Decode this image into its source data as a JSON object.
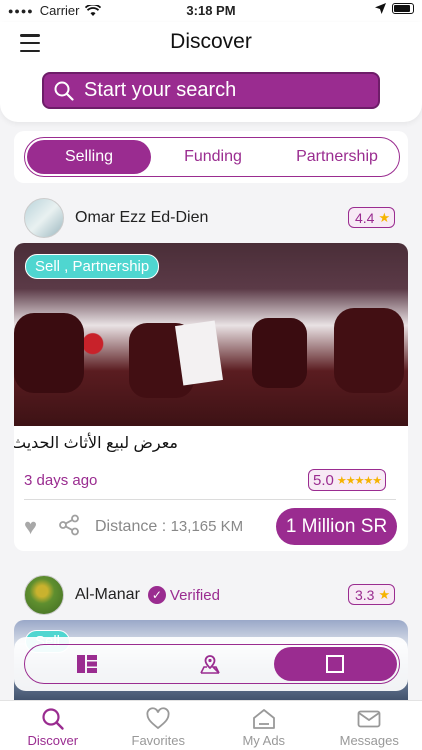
{
  "status_bar": {
    "carrier": "Carrier",
    "time": "3:18 PM"
  },
  "header": {
    "title": "Discover",
    "menu_icon": "hamburger-menu-icon"
  },
  "search": {
    "placeholder": "Start your search",
    "icon": "search-icon"
  },
  "segments": {
    "items": [
      "Selling",
      "Funding",
      "Partnership"
    ],
    "selected": "Selling"
  },
  "listings": [
    {
      "user": "Omar Ezz Ed-Dien",
      "user_rating": "4.4",
      "badge": "Sell , Partnership",
      "title": "معرض لبيع الأثاث الحديث",
      "posted": "3 days ago",
      "rating": "5.0",
      "distance_label": "Distance :",
      "distance_value": "13,165 KM",
      "price": "1 Million SR"
    },
    {
      "user": "Al-Manar",
      "verified_label": "Verified",
      "user_rating": "3.3",
      "badge": "Sell"
    }
  ],
  "view_toggle": {
    "options": [
      "grid-view-icon",
      "map-view-icon",
      "card-view-icon"
    ],
    "selected": "card-view-icon"
  },
  "tabbar": {
    "items": [
      {
        "label": "Discover",
        "icon": "search-icon"
      },
      {
        "label": "Favorites",
        "icon": "heart-icon"
      },
      {
        "label": "My Ads",
        "icon": "home-icon"
      },
      {
        "label": "Messages",
        "icon": "envelope-icon"
      }
    ],
    "active": "Discover"
  },
  "colors": {
    "accent": "#9a2c90",
    "badge": "#4fd6d0",
    "star": "#f5b301"
  }
}
